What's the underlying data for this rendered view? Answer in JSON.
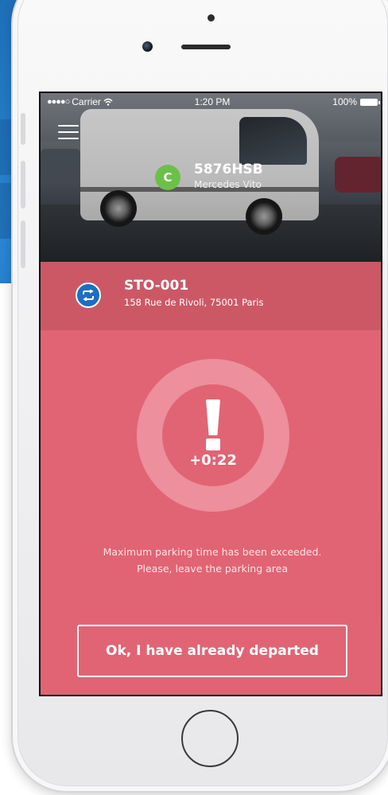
{
  "status_bar": {
    "carrier": "Carrier",
    "time": "1:20 PM",
    "battery": "100%"
  },
  "vehicle": {
    "badge": "C",
    "badge_color": "#6cc04a",
    "plate": "5876HSB",
    "model": "Mercedes Vito"
  },
  "location": {
    "code": "STO-001",
    "address": "158 Rue de Rivoli, 75001 Paris",
    "icon": "swap-icon",
    "icon_color": "#1d6fc4"
  },
  "alert": {
    "icon": "exclamation-icon",
    "overtime": "+0:22",
    "message": "Maximum parking time has been exceeded. Please, leave the parking area"
  },
  "actions": {
    "departed_label": "Ok, I have already departed"
  },
  "colors": {
    "alert_background": "#e16474",
    "location_bar": "#cc5866",
    "ring": "#ed8f9c"
  }
}
